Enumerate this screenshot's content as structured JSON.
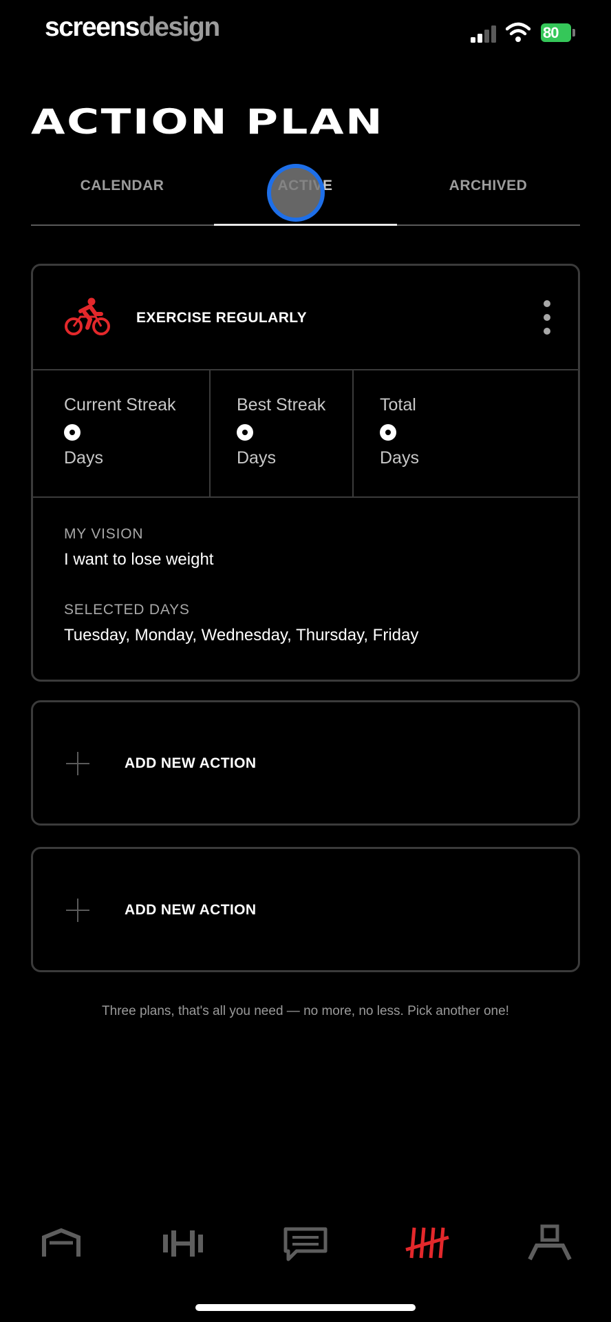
{
  "status_bar": {
    "brand_primary": "screens",
    "brand_secondary": "design",
    "battery": "80"
  },
  "page": {
    "title": "ACTION PLAN"
  },
  "tabs": [
    {
      "label": "CALENDAR",
      "active": false
    },
    {
      "label": "ACTIVE",
      "active": true
    },
    {
      "label": "ARCHIVED",
      "active": false
    }
  ],
  "plan": {
    "icon": "bike-icon",
    "title": "EXERCISE REGULARLY",
    "stats": [
      {
        "label": "Current Streak",
        "value": "0",
        "unit": "Days"
      },
      {
        "label": "Best Streak",
        "value": "0",
        "unit": "Days"
      },
      {
        "label": "Total",
        "value": "0",
        "unit": "Days"
      }
    ],
    "vision_label": "MY VISION",
    "vision_text": "I want to lose weight",
    "days_label": "SELECTED DAYS",
    "days_text": "Tuesday, Monday, Wednesday, Thursday, Friday"
  },
  "add_actions": [
    {
      "label": "ADD NEW ACTION"
    },
    {
      "label": "ADD NEW ACTION"
    }
  ],
  "footnote": "Three plans, that's all you need — no more, no less. Pick another one!",
  "bottom_nav": [
    {
      "icon": "home-icon",
      "active": false
    },
    {
      "icon": "dumbbell-icon",
      "active": false
    },
    {
      "icon": "chat-icon",
      "active": false
    },
    {
      "icon": "tally-icon",
      "active": true
    },
    {
      "icon": "profile-icon",
      "active": false
    }
  ],
  "colors": {
    "accent": "#e3282b",
    "battery_green": "#35c759",
    "touch_ring": "#1e6fe8",
    "border": "#3b3b3b"
  }
}
